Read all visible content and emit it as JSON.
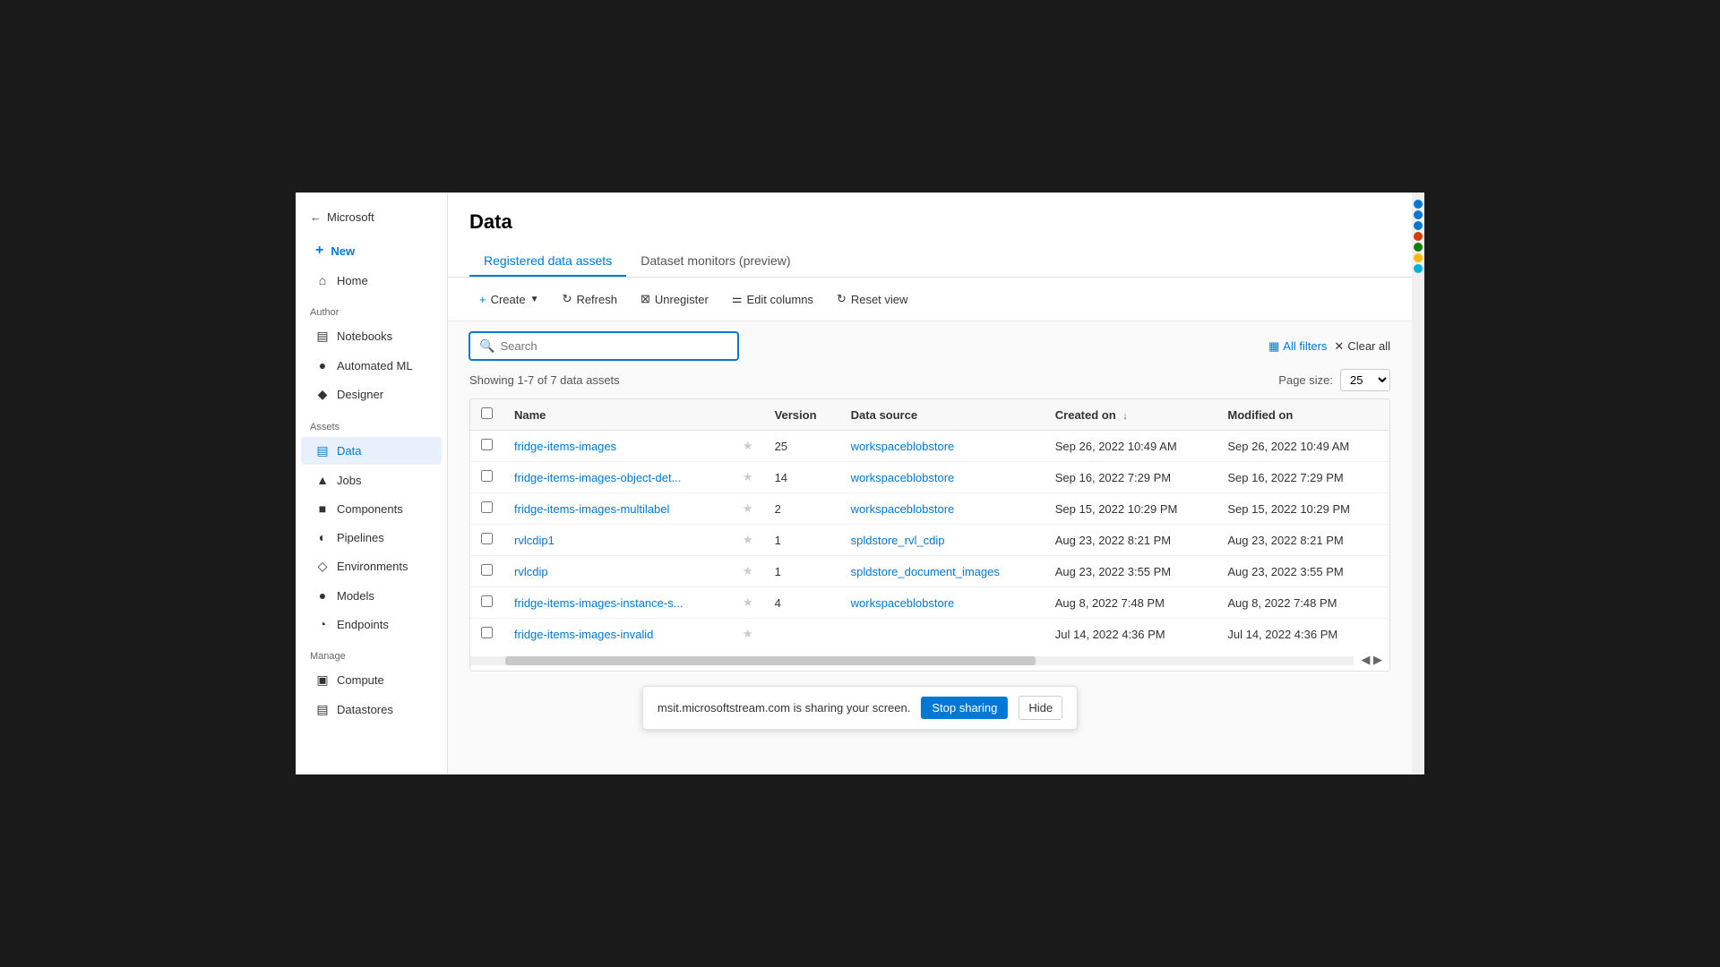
{
  "sidebar": {
    "back_label": "Microsoft",
    "new_label": "New",
    "items": [
      {
        "id": "home",
        "label": "Home",
        "icon": "🏠"
      },
      {
        "id": "notebooks",
        "label": "Notebooks",
        "icon": "📓"
      },
      {
        "id": "automated-ml",
        "label": "Automated ML",
        "icon": "🔄"
      },
      {
        "id": "designer",
        "label": "Designer",
        "icon": "🔷"
      }
    ],
    "section_author": "Author",
    "section_assets": "Assets",
    "section_manage": "Manage",
    "assets_items": [
      {
        "id": "data",
        "label": "Data",
        "icon": "📊",
        "active": true
      },
      {
        "id": "jobs",
        "label": "Jobs",
        "icon": "🔺"
      },
      {
        "id": "components",
        "label": "Components",
        "icon": "📦"
      },
      {
        "id": "pipelines",
        "label": "Pipelines",
        "icon": "🔗"
      },
      {
        "id": "environments",
        "label": "Environments",
        "icon": "🌐"
      },
      {
        "id": "models",
        "label": "Models",
        "icon": "🧠"
      },
      {
        "id": "endpoints",
        "label": "Endpoints",
        "icon": "🎯"
      }
    ],
    "manage_items": [
      {
        "id": "compute",
        "label": "Compute",
        "icon": "💻"
      },
      {
        "id": "datastores",
        "label": "Datastores",
        "icon": "🗄️"
      }
    ]
  },
  "page": {
    "title": "Data",
    "tabs": [
      {
        "id": "registered",
        "label": "Registered data assets",
        "active": true
      },
      {
        "id": "monitors",
        "label": "Dataset monitors (preview)",
        "active": false
      }
    ]
  },
  "toolbar": {
    "create_label": "Create",
    "refresh_label": "Refresh",
    "unregister_label": "Unregister",
    "edit_columns_label": "Edit columns",
    "reset_view_label": "Reset view"
  },
  "search": {
    "placeholder": "Search",
    "all_filters_label": "All filters",
    "clear_all_label": "Clear all"
  },
  "table": {
    "showing_text": "Showing 1-7 of 7 data assets",
    "page_size_label": "Page size:",
    "page_size_value": "25",
    "columns": [
      "Name",
      "Version",
      "Data source",
      "Created on",
      "Modified on"
    ],
    "rows": [
      {
        "name": "fridge-items-images",
        "version": "25",
        "data_source": "workspaceblobstore",
        "created_on": "Sep 26, 2022 10:49 AM",
        "modified_on": "Sep 26, 2022 10:49 AM"
      },
      {
        "name": "fridge-items-images-object-det...",
        "version": "14",
        "data_source": "workspaceblobstore",
        "created_on": "Sep 16, 2022 7:29 PM",
        "modified_on": "Sep 16, 2022 7:29 PM"
      },
      {
        "name": "fridge-items-images-multilabel",
        "version": "2",
        "data_source": "workspaceblobstore",
        "created_on": "Sep 15, 2022 10:29 PM",
        "modified_on": "Sep 15, 2022 10:29 PM"
      },
      {
        "name": "rvlcdip1",
        "version": "1",
        "data_source": "spldstore_rvl_cdip",
        "created_on": "Aug 23, 2022 8:21 PM",
        "modified_on": "Aug 23, 2022 8:21 PM"
      },
      {
        "name": "rvlcdip",
        "version": "1",
        "data_source": "spldstore_document_images",
        "created_on": "Aug 23, 2022 3:55 PM",
        "modified_on": "Aug 23, 2022 3:55 PM"
      },
      {
        "name": "fridge-items-images-instance-s...",
        "version": "4",
        "data_source": "workspaceblobstore",
        "created_on": "Aug 8, 2022 7:48 PM",
        "modified_on": "Aug 8, 2022 7:48 PM"
      },
      {
        "name": "fridge-items-images-invalid",
        "version": "",
        "data_source": "",
        "created_on": "Jul 14, 2022 4:36 PM",
        "modified_on": "Jul 14, 2022 4:36 PM"
      }
    ]
  },
  "toast": {
    "message": "msit.microsoftstream.com is sharing your screen.",
    "stop_label": "Stop sharing",
    "hide_label": "Hide"
  },
  "right_bar": {
    "dots": [
      "blue",
      "blue",
      "blue",
      "orange",
      "green",
      "yellow",
      "blue2"
    ]
  }
}
